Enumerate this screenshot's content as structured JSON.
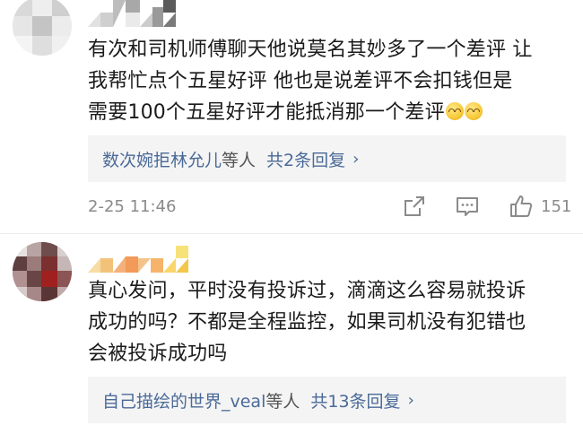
{
  "comments": [
    {
      "username_image": "pixelated-username",
      "avatar_image": "pixelated-avatar",
      "lines": [
        "有次和司机师傅聊天他说莫名其妙多了一个差评 让",
        "我帮忙点个五星好评  他也是说差评不会扣钱但是",
        "需要100个五星好评才能抵消那一个差评"
      ],
      "emojis": [
        "grin-emoji",
        "grin-emoji"
      ],
      "replies": {
        "users": "数次婉拒林允儿",
        "suffix": "等人",
        "count": "共2条回复",
        "chevron": "›"
      },
      "timestamp": "2-25 11:46",
      "likes": "151",
      "actions": [
        "share-icon",
        "comment-icon",
        "thumbs-up-icon"
      ]
    },
    {
      "username_image": "pixelated-username",
      "avatar_image": "pixelated-avatar",
      "lines": [
        "真心发问，平时没有投诉过，滴滴这么容易就投诉",
        "成功的吗？不都是全程监控，如果司机没有犯错也",
        "会被投诉成功吗"
      ],
      "replies": {
        "users": "自己描绘的世界_veal",
        "suffix": "等人",
        "count": "共13条回复",
        "chevron": "›"
      }
    }
  ],
  "colors": {
    "link": "#4a6a98",
    "meta": "#8a8a8a",
    "reply_bg": "#f4f4f4"
  }
}
